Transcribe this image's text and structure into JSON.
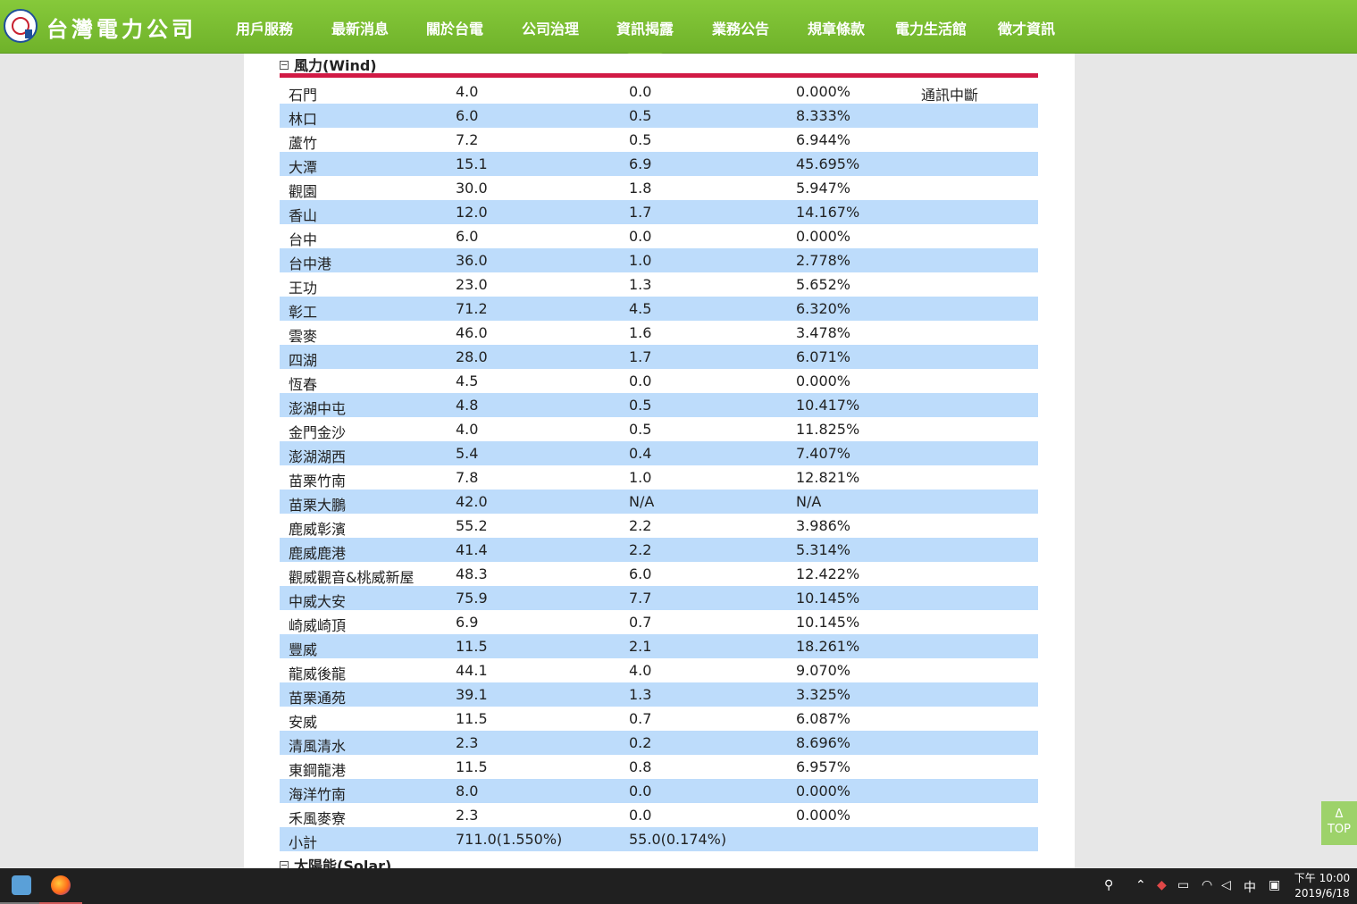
{
  "header": {
    "brand": "台灣電力公司",
    "nav": [
      {
        "label": "用戶服務"
      },
      {
        "label": "最新消息"
      },
      {
        "label": "關於台電"
      },
      {
        "label": "公司治理"
      },
      {
        "label": "資訊揭露"
      },
      {
        "label": "業務公告"
      },
      {
        "label": "規章條款"
      },
      {
        "label": "電力生活館"
      },
      {
        "label": "徵才資訊"
      }
    ],
    "active_nav": "資訊揭露"
  },
  "sections": [
    {
      "title": "風力(Wind)"
    },
    {
      "title": "太陽能(Solar)"
    }
  ],
  "wind_rows": [
    [
      "石門",
      "4.0",
      "0.0",
      "0.000%",
      "通訊中斷"
    ],
    [
      "林口",
      "6.0",
      "0.5",
      "8.333%",
      ""
    ],
    [
      "蘆竹",
      "7.2",
      "0.5",
      "6.944%",
      ""
    ],
    [
      "大潭",
      "15.1",
      "6.9",
      "45.695%",
      ""
    ],
    [
      "觀園",
      "30.0",
      "1.8",
      "5.947%",
      ""
    ],
    [
      "香山",
      "12.0",
      "1.7",
      "14.167%",
      ""
    ],
    [
      "台中",
      "6.0",
      "0.0",
      "0.000%",
      ""
    ],
    [
      "台中港",
      "36.0",
      "1.0",
      "2.778%",
      ""
    ],
    [
      "王功",
      "23.0",
      "1.3",
      "5.652%",
      ""
    ],
    [
      "彰工",
      "71.2",
      "4.5",
      "6.320%",
      ""
    ],
    [
      "雲麥",
      "46.0",
      "1.6",
      "3.478%",
      ""
    ],
    [
      "四湖",
      "28.0",
      "1.7",
      "6.071%",
      ""
    ],
    [
      "恆春",
      "4.5",
      "0.0",
      "0.000%",
      ""
    ],
    [
      "澎湖中屯",
      "4.8",
      "0.5",
      "10.417%",
      ""
    ],
    [
      "金門金沙",
      "4.0",
      "0.5",
      "11.825%",
      ""
    ],
    [
      "澎湖湖西",
      "5.4",
      "0.4",
      "7.407%",
      ""
    ],
    [
      "苗栗竹南",
      "7.8",
      "1.0",
      "12.821%",
      ""
    ],
    [
      "苗栗大鵬",
      "42.0",
      "N/A",
      "N/A",
      ""
    ],
    [
      "鹿威彰濱",
      "55.2",
      "2.2",
      "3.986%",
      ""
    ],
    [
      "鹿威鹿港",
      "41.4",
      "2.2",
      "5.314%",
      ""
    ],
    [
      "觀威觀音&桃威新屋",
      "48.3",
      "6.0",
      "12.422%",
      ""
    ],
    [
      "中威大安",
      "75.9",
      "7.7",
      "10.145%",
      ""
    ],
    [
      "崎威崎頂",
      "6.9",
      "0.7",
      "10.145%",
      ""
    ],
    [
      "豐威",
      "11.5",
      "2.1",
      "18.261%",
      ""
    ],
    [
      "龍威後龍",
      "44.1",
      "4.0",
      "9.070%",
      ""
    ],
    [
      "苗栗通苑",
      "39.1",
      "1.3",
      "3.325%",
      ""
    ],
    [
      "安威",
      "11.5",
      "0.7",
      "6.087%",
      ""
    ],
    [
      "清風清水",
      "2.3",
      "0.2",
      "8.696%",
      ""
    ],
    [
      "東鋼龍港",
      "11.5",
      "0.8",
      "6.957%",
      ""
    ],
    [
      "海洋竹南",
      "8.0",
      "0.0",
      "0.000%",
      ""
    ],
    [
      "禾風麥寮",
      "2.3",
      "0.0",
      "0.000%",
      ""
    ],
    [
      "小計",
      "711.0(1.550%)",
      "55.0(0.174%)",
      "",
      ""
    ]
  ],
  "top_button": {
    "arrow": "Δ",
    "label": "TOP"
  },
  "taskbar": {
    "apps": [
      "file-manager-icon",
      "firefox-icon"
    ],
    "tray_ime": "中",
    "clock_time": "下午 10:00",
    "clock_date": "2019/6/18"
  },
  "colors": {
    "header_green": "#7cbf33",
    "row_alt_blue": "#bddcfb",
    "rule_red": "#d11a45"
  }
}
